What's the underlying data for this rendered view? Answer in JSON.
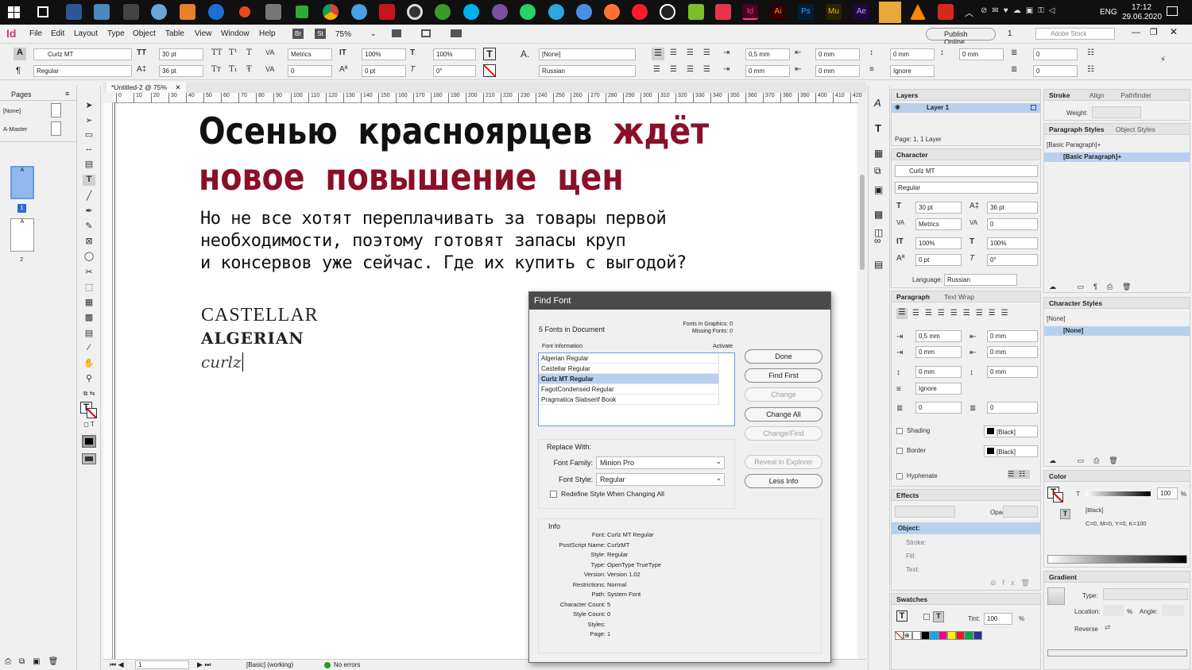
{
  "taskbar": {
    "time": "17:12",
    "date": "29.06.2020",
    "lang": "ENG"
  },
  "menubar": {
    "app_icon": "Id",
    "items": [
      "File",
      "Edit",
      "Layout",
      "Type",
      "Object",
      "Table",
      "View",
      "Window",
      "Help"
    ],
    "bridge": "Br",
    "stock": "St",
    "zoom": "75%",
    "publish": "Publish Online",
    "page_num": "1",
    "search_placeholder": "Adobe Stock"
  },
  "control": {
    "font": "Curlz MT",
    "style": "Regular",
    "size": "30 pt",
    "leading": "36 pt",
    "kerning": "Metrics",
    "tracking": "0",
    "vscale": "100%",
    "hscale": "100%",
    "baseline": "0 pt",
    "skew": "0°",
    "charstyle": "[None]",
    "lang": "Russian",
    "indent_l": "0,5 mm",
    "indent_r": "0 mm",
    "first_line": "0 mm",
    "last_line": "0 mm",
    "space_b": "0 mm",
    "space_a": "0 mm",
    "dropcap": "0",
    "dropcap2": "0",
    "ignore": "Ignore",
    "mm0": "0 mm"
  },
  "pages_panel": {
    "title": "Pages",
    "none": "[None]",
    "master": "A-Master",
    "page1": "1",
    "page2": "2",
    "a": "A"
  },
  "document": {
    "tab": "*Untitled-2 @ 75%",
    "ruler": [
      "0",
      "10",
      "20",
      "30",
      "40",
      "50",
      "60",
      "70",
      "80",
      "90",
      "100",
      "110",
      "120",
      "130",
      "140",
      "150",
      "160",
      "170",
      "180",
      "190",
      "200",
      "210",
      "220",
      "230",
      "240",
      "250",
      "260",
      "270",
      "280",
      "290",
      "300",
      "310",
      "320",
      "330",
      "340",
      "350",
      "360",
      "370",
      "380",
      "390",
      "400",
      "410",
      "420"
    ],
    "headline1_black": "Осенью красноярцев",
    "headline1_red": "ждёт",
    "headline2": "новое повышение цен",
    "body1": "Но не все хотят переплачивать за товары первой",
    "body2": "необходимости, поэтому готовят запасы круп",
    "body3": "и консервов уже сейчас. Где их купить с выгодой?",
    "font1": "CASTELLAR",
    "font2": "ALGERIAN",
    "font3": "curlz"
  },
  "statusbar": {
    "page": "1",
    "style": "[Basic] (working)",
    "errors": "No errors"
  },
  "dialog": {
    "title": "Find Font",
    "fonts_in_doc": "5 Fonts in Document",
    "fonts_in_graphics": "Fonts in Graphics: 0",
    "missing_fonts": "Missing Fonts: 0",
    "col_info": "Font Information",
    "col_activate": "Activate",
    "fonts": [
      "Algerian Regular",
      "Castellar Regular",
      "Curlz MT Regular",
      "FagotCondensed Regular",
      "Pragmatica Slabserif Book"
    ],
    "selected_index": 2,
    "buttons": {
      "done": "Done",
      "find_first": "Find First",
      "change": "Change",
      "change_all": "Change All",
      "change_find": "Change/Find",
      "reveal": "Reveal in Explorer",
      "less_info": "Less Info"
    },
    "replace_with": "Replace With:",
    "font_family_label": "Font Family:",
    "font_family": "Minion Pro",
    "font_style_label": "Font Style:",
    "font_style": "Regular",
    "redefine": "Redefine Style When Changing All",
    "info_title": "Info",
    "info": [
      {
        "k": "Font:",
        "v": "Curlz MT Regular"
      },
      {
        "k": "PostScript Name:",
        "v": "CurlzMT"
      },
      {
        "k": "Style:",
        "v": "Regular"
      },
      {
        "k": "Type:",
        "v": "OpenType TrueType"
      },
      {
        "k": "Version:",
        "v": "Version 1.02"
      },
      {
        "k": "Restrictions:",
        "v": "Normal"
      },
      {
        "k": "Path:",
        "v": "System Font"
      },
      {
        "k": "Character Count:",
        "v": "5"
      },
      {
        "k": "Style Count:",
        "v": "0"
      },
      {
        "k": "Styles:",
        "v": ""
      },
      {
        "k": "Page:",
        "v": "1"
      }
    ]
  },
  "layers": {
    "title": "Layers",
    "layer": "Layer 1",
    "footer": "Page: 1, 1 Layer"
  },
  "character": {
    "title": "Character",
    "font": "Curlz MT",
    "style": "Regular",
    "size": "30 pt",
    "leading": "36 pt",
    "kerning": "Metrics",
    "tracking": "0",
    "vscale": "100%",
    "hscale": "100%",
    "baseline": "0 pt",
    "skew": "0°",
    "lang_label": "Language:",
    "lang": "Russian"
  },
  "paragraph": {
    "title": "Paragraph",
    "tab2": "Text Wrap",
    "indent_l": "0,5 mm",
    "indent_r": "0 mm",
    "first": "0 mm",
    "last": "0 mm",
    "space_b": "0 mm",
    "space_a": "0 mm",
    "ignore": "Ignore",
    "dc1": "0",
    "dc2": "0",
    "shading": "Shading",
    "border": "Border",
    "black1": "[Black]",
    "black2": "[Black]",
    "hyphenate": "Hyphenate"
  },
  "effects": {
    "title": "Effects",
    "opacity_label": "Opacity:",
    "object": "Object:",
    "stroke": "Stroke:",
    "fill": "Fill:",
    "text": "Text:"
  },
  "swatches": {
    "title": "Swatches",
    "tint_label": "Tint:",
    "tint": "100",
    "pct": "%"
  },
  "stroke_panel": {
    "tab1": "Stroke",
    "tab2": "Align",
    "tab3": "Pathfinder",
    "weight": "Weight:"
  },
  "para_styles": {
    "tab1": "Paragraph Styles",
    "tab2": "Object Styles",
    "current": "[Basic Paragraph]+",
    "item": "[Basic Paragraph]+"
  },
  "char_styles": {
    "title": "Character Styles",
    "current": "[None]",
    "item": "[None]"
  },
  "color_panel": {
    "title": "Color",
    "t": "T",
    "value": "100",
    "pct": "%",
    "black": "[Black]",
    "cmyk": "C=0, M=0, Y=0, K=100"
  },
  "gradient": {
    "title": "Gradient",
    "type": "Type:",
    "location": "Location:",
    "angle": "Angle:",
    "reverse": "Reverse",
    "pct": "%"
  },
  "colors": {
    "accent_red": "#8b0f26",
    "headline_black": "#111111",
    "selection": "#b6d0ee"
  }
}
